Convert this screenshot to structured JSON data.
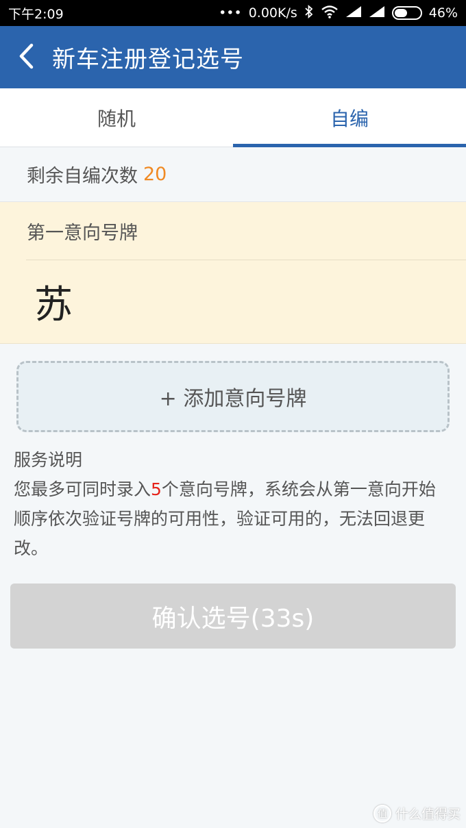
{
  "status_bar": {
    "time": "下午2:09",
    "network_speed": "0.00K/s",
    "battery_percent": "46%",
    "battery_level": 0.46,
    "icons": [
      "dots-icon",
      "bluetooth-icon",
      "wifi-icon",
      "signal-icon",
      "signal-icon",
      "battery-icon"
    ]
  },
  "app_bar": {
    "title": "新车注册登记选号",
    "back_icon": "chevron-left-icon",
    "color": "#2b64ad"
  },
  "tabs": [
    {
      "label": "随机",
      "active": false
    },
    {
      "label": "自编",
      "active": true
    }
  ],
  "remaining": {
    "label": "剩余自编次数",
    "count": "20",
    "count_color": "#f08a24"
  },
  "plate_card": {
    "label": "第一意向号牌",
    "value": "苏"
  },
  "add_plate_button": {
    "label": "+ 添加意向号牌"
  },
  "service": {
    "title": "服务说明",
    "body_prefix": "您最多可同时录入",
    "highlight": "5",
    "body_suffix": "个意向号牌，系统会从第一意向开始顺序依次验证号牌的可用性，验证可用的，无法回退更改。",
    "highlight_color": "#e5231b"
  },
  "confirm_button": {
    "label": "确认选号(33s)",
    "enabled": false
  },
  "watermark": {
    "icon": "zhi-logo-icon",
    "glyph": "值",
    "text": "什么值得买"
  }
}
